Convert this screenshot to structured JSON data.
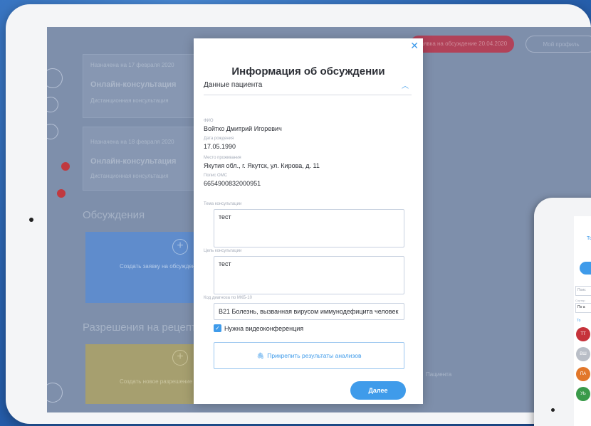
{
  "background_app": {
    "cards": [
      {
        "date": "Назначена на 17 февраля 2020",
        "title": "Онлайн-консультация",
        "subtitle": "Дистанционная консультация"
      },
      {
        "date": "Назначена на 18 февраля 2020",
        "title": "Онлайн-консультация",
        "subtitle": "Дистанционная консультация"
      }
    ],
    "section_discussions": "Обсуждения",
    "create_request_label": "Создать заявку на обсуждение",
    "section_prescriptions": "Разрешения на рецепт",
    "create_prescription_label": "Создать новое разрешение",
    "pill_request": "Заявка на обсуждение 20.04.2020",
    "pill_secondary": "Мой профиль",
    "patient_label": "Пациента"
  },
  "modal": {
    "title": "Информация об обсуждении",
    "section_label": "Данные пациента",
    "fields": [
      {
        "label": "ФИО",
        "value": "Войтко Дмитрий Игоревич"
      },
      {
        "label": "Дата рождения",
        "value": "17.05.1990"
      },
      {
        "label": "Место проживания",
        "value": "Якутия обл., г. Якутск, ул. Кирова, д. 11"
      },
      {
        "label": "Полис ОМС",
        "value": "6654900832000951"
      }
    ],
    "topic_label": "Тема консультации",
    "topic_value": "тест",
    "goal_label": "Цель консультации",
    "goal_value": "тест",
    "diagnosis_label": "Код диагноза по МКБ-10",
    "diagnosis_value": "B21 Болезнь, вызванная вирусом иммунодефицита человек",
    "video_checkbox_label": "Нужна видеоконференция",
    "video_checked": true,
    "attach_label": "Прикрепить результаты анализов",
    "next_label": "Далее"
  },
  "phone": {
    "tab_label": "То",
    "field1_placeholder": "Поис",
    "sort_label": "Сортир",
    "sort_value": "По а",
    "check_label": "То",
    "avatars": [
      {
        "initials": "ТТ",
        "color": "#c6333b"
      },
      {
        "initials": "ВШ",
        "color": "#b9bec7"
      },
      {
        "initials": "ПА",
        "color": "#e2772a"
      },
      {
        "initials": "УЬ",
        "color": "#3a9a4a"
      }
    ]
  },
  "colors": {
    "accent": "#3f9bea",
    "danger": "#c1393f"
  }
}
